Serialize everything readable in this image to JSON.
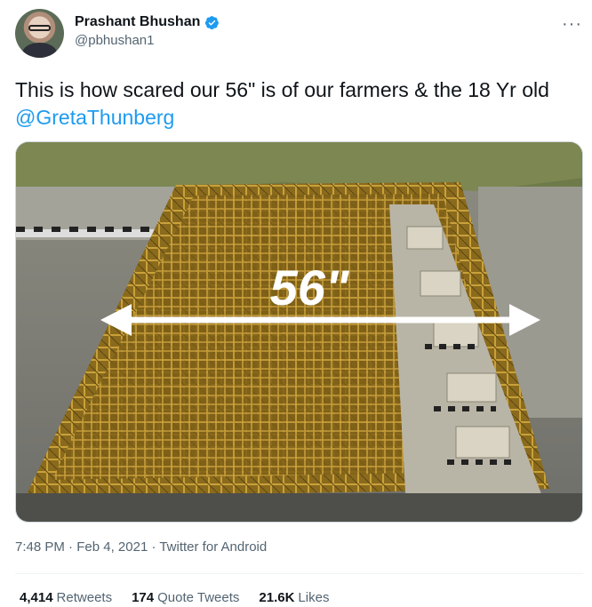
{
  "author": {
    "display_name": "Prashant Bhushan",
    "handle": "@pbhushan1",
    "verified": true
  },
  "tweet": {
    "text_before": "This is how scared our 56\" is of our farmers & the 18 Yr old ",
    "mention": "@GretaThunberg",
    "image_overlay_text": "56\"",
    "time": "7:48 PM",
    "date": "Feb 4, 2021",
    "source": "Twitter for Android",
    "separator": " · "
  },
  "stats": {
    "retweets": {
      "count": "4,414",
      "label": "Retweets"
    },
    "quotes": {
      "count": "174",
      "label": "Quote Tweets"
    },
    "likes": {
      "count": "21.6K",
      "label": "Likes"
    }
  },
  "colors": {
    "accent": "#1d9bf0",
    "secondary_text": "#536471",
    "primary_text": "#0f1419"
  },
  "icons": {
    "verified": "verified-badge-icon",
    "more": "more-options-icon"
  }
}
